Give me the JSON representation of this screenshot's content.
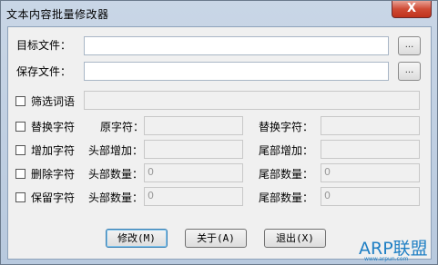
{
  "window": {
    "title": "文本内容批量修改器",
    "close_glyph": "X"
  },
  "files": {
    "target_label": "目标文件：",
    "target_value": "",
    "save_label": "保存文件：",
    "save_value": "",
    "browse_label": "..."
  },
  "filter": {
    "label": "筛选词语",
    "value": "",
    "checked": false
  },
  "replace": {
    "label": "替换字符",
    "original_label": "原字符：",
    "original_value": "",
    "new_label": "替换字符：",
    "new_value": ""
  },
  "add": {
    "label": "增加字符",
    "head_label": "头部增加：",
    "head_value": "",
    "tail_label": "尾部增加：",
    "tail_value": ""
  },
  "delete": {
    "label": "删除字符",
    "head_label": "头部数量：",
    "head_value": "0",
    "tail_label": "尾部数量：",
    "tail_value": "0"
  },
  "keep": {
    "label": "保留字符",
    "head_label": "头部数量：",
    "head_value": "0",
    "tail_label": "尾部数量：",
    "tail_value": "0"
  },
  "buttons": {
    "modify": "修改(M)",
    "about": "关于(A)",
    "exit": "退出(X)"
  },
  "watermark": {
    "text": "ARP联盟",
    "sub": "www.arpun.com"
  }
}
